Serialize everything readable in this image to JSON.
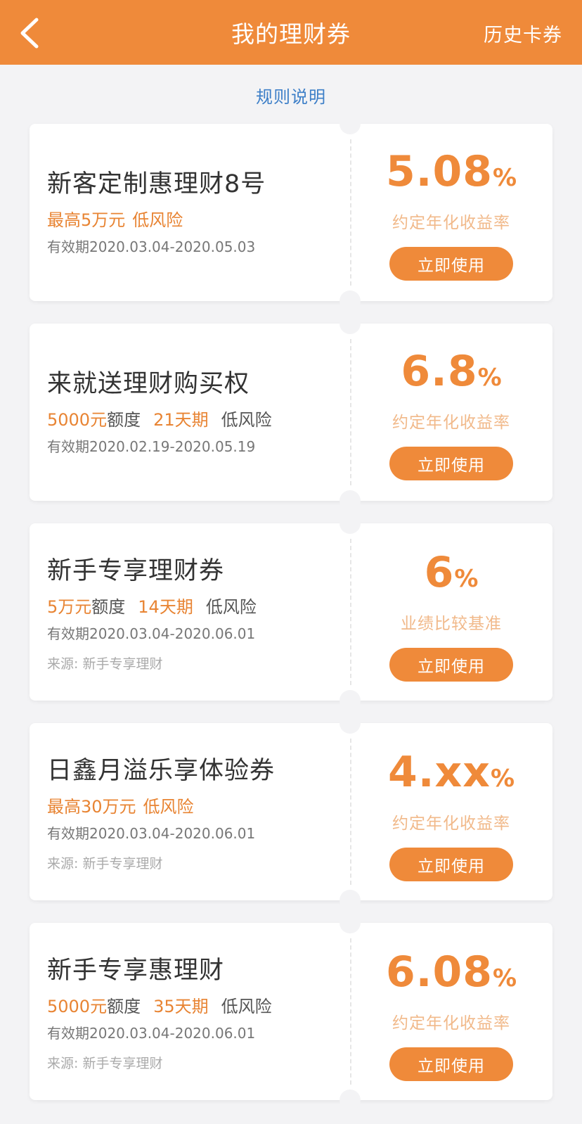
{
  "header": {
    "title": "我的理财券",
    "history_label": "历史卡券",
    "back_icon": "chevron-left-icon",
    "background": "#ef8a3a"
  },
  "rules_label": "规则说明",
  "use_label": "立即使用",
  "cards": [
    {
      "title": "新客定制惠理财8号",
      "tags": [
        {
          "text": "最高5万元",
          "style": "orange"
        },
        {
          "text": "低风险",
          "style": "orange"
        }
      ],
      "validity": "有效期2020.03.04-2020.05.03",
      "source": "",
      "rate_num": "5.08",
      "rate_unit": "%",
      "rate_label": "约定年化收益率"
    },
    {
      "title": "来就送理财购买权",
      "tags": [
        {
          "text": "5000元",
          "style": "orange"
        },
        {
          "text": "额度",
          "style": "gray"
        },
        {
          "text": "21天期",
          "style": "orange"
        },
        {
          "text": "低风险",
          "style": "gray"
        }
      ],
      "validity": "有效期2020.02.19-2020.05.19",
      "source": "",
      "rate_num": "6.8",
      "rate_unit": "%",
      "rate_label": "约定年化收益率"
    },
    {
      "title": "新手专享理财券",
      "tags": [
        {
          "text": "5万元",
          "style": "orange"
        },
        {
          "text": "额度",
          "style": "gray"
        },
        {
          "text": "14天期",
          "style": "orange"
        },
        {
          "text": "低风险",
          "style": "gray"
        }
      ],
      "validity": "有效期2020.03.04-2020.06.01",
      "source": "来源: 新手专享理财",
      "rate_num": "6",
      "rate_unit": "%",
      "rate_label": "业绩比较基准"
    },
    {
      "title": "日鑫月溢乐享体验券",
      "tags": [
        {
          "text": "最高30万元",
          "style": "orange"
        },
        {
          "text": "低风险",
          "style": "orange"
        }
      ],
      "validity": "有效期2020.03.04-2020.06.01",
      "source": "来源: 新手专享理财",
      "rate_num": "4.xx",
      "rate_unit": "%",
      "rate_label": "约定年化收益率"
    },
    {
      "title": "新手专享惠理财",
      "tags": [
        {
          "text": "5000元",
          "style": "orange"
        },
        {
          "text": "额度",
          "style": "gray"
        },
        {
          "text": "35天期",
          "style": "orange"
        },
        {
          "text": "低风险",
          "style": "gray"
        }
      ],
      "validity": "有效期2020.03.04-2020.06.01",
      "source": "来源: 新手专享理财",
      "rate_num": "6.08",
      "rate_unit": "%",
      "rate_label": "约定年化收益率"
    }
  ]
}
